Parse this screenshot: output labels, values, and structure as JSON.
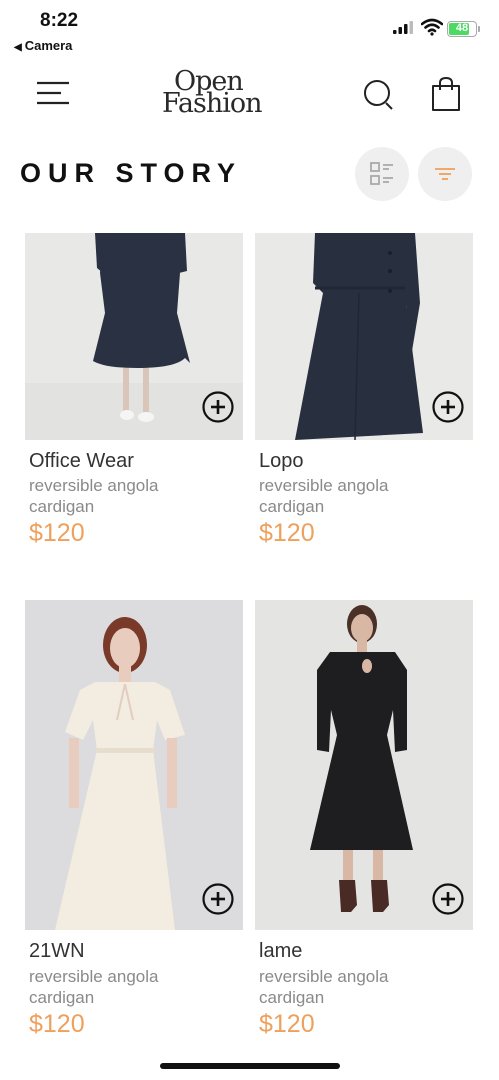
{
  "status_bar": {
    "time": "8:22",
    "back_label": "Camera",
    "battery": "48"
  },
  "header": {
    "logo_line1": "Open",
    "logo_line2": "Fashion"
  },
  "page": {
    "title": "OUR STORY"
  },
  "colors": {
    "price": "#eea05c",
    "filter_icon": "#eea05c"
  },
  "products": [
    {
      "name": "Office Wear",
      "desc_line1": "reversible angola",
      "desc_line2": "cardigan",
      "price": "$120"
    },
    {
      "name": "Lopo",
      "desc_line1": "reversible angola",
      "desc_line2": "cardigan",
      "price": "$120"
    },
    {
      "name": "21WN",
      "desc_line1": "reversible angola",
      "desc_line2": "cardigan",
      "price": "$120"
    },
    {
      "name": "lame",
      "desc_line1": "reversible angola",
      "desc_line2": "cardigan",
      "price": "$120"
    }
  ]
}
